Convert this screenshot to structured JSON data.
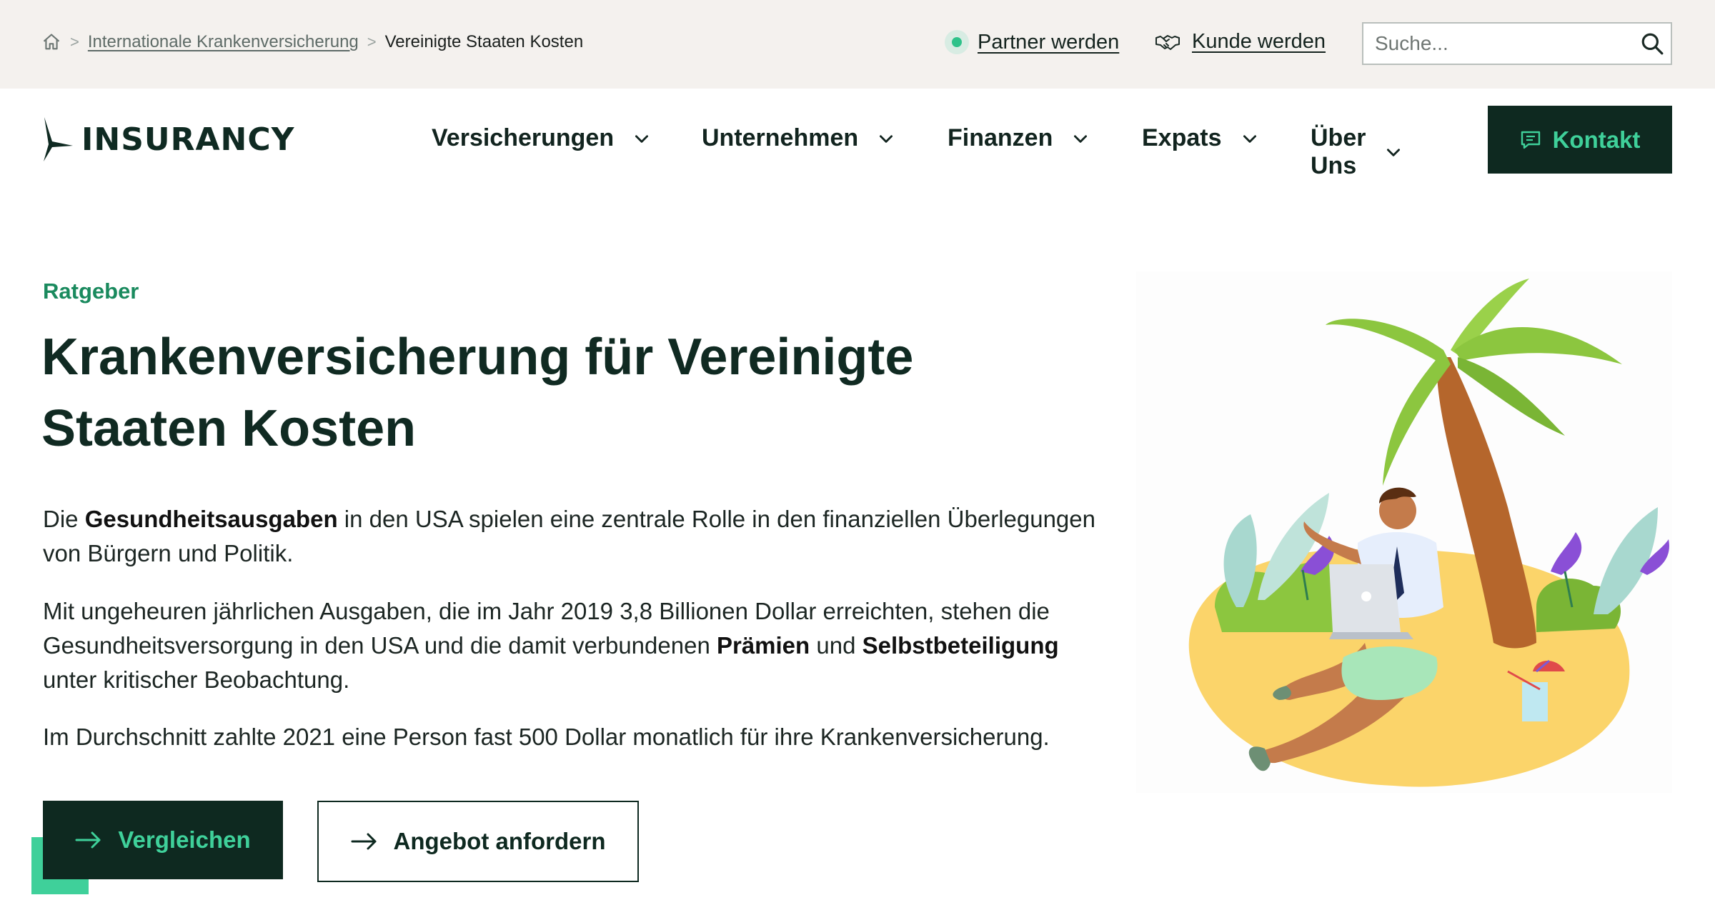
{
  "breadcrumb": {
    "home_icon": "home-icon",
    "items": [
      {
        "label": "Internationale Krankenversicherung",
        "link": true
      },
      {
        "label": "Vereinigte Staaten Kosten",
        "link": false
      }
    ],
    "separator": ">"
  },
  "utility": {
    "partner_label": "Partner werden",
    "partner_icon": "green-dot-icon",
    "customer_label": "Kunde werden",
    "customer_icon": "handshake-icon",
    "search_placeholder": "Suche...",
    "search_icon": "search-icon"
  },
  "brand": {
    "name": "INSURANCY",
    "logo_icon": "bird-logo-icon"
  },
  "nav": {
    "items": [
      {
        "label": "Versicherungen"
      },
      {
        "label": "Unternehmen"
      },
      {
        "label": "Finanzen"
      },
      {
        "label": "Expats"
      },
      {
        "label": "Über Uns"
      }
    ],
    "contact_label": "Kontakt",
    "contact_icon": "message-icon"
  },
  "hero": {
    "eyebrow": "Ratgeber",
    "title": "Krankenversicherung für Vereinigte Staaten Kosten",
    "p1_a": "Die ",
    "p1_b": "Gesundheitsausgaben",
    "p1_c": " in den USA spielen eine zentrale Rolle in den finanziellen Überlegungen von Bürgern und Politik.",
    "p2_a": "Mit ungeheuren jährlichen Ausgaben, die im Jahr 2019 3,8 Billionen Dollar erreichten, stehen die Gesundheitsversorgung in den USA und die damit verbundenen ",
    "p2_b": "Prämien",
    "p2_c": " und ",
    "p2_d": "Selbstbeteiligung",
    "p2_e": " unter kritischer Beobachtung.",
    "p3": "Im Durchschnitt zahlte 2021 eine Person fast 500 Dollar monatlich für ihre Krankenversicherung.",
    "compare_label": "Vergleichen",
    "quote_label": "Angebot anfordern",
    "button_icon": "arrow-right-icon"
  },
  "colors": {
    "accent": "#3fd09a",
    "dark": "#0e2920",
    "eyebrow": "#1a8a5e",
    "topbar_bg": "#f4f1ee"
  }
}
